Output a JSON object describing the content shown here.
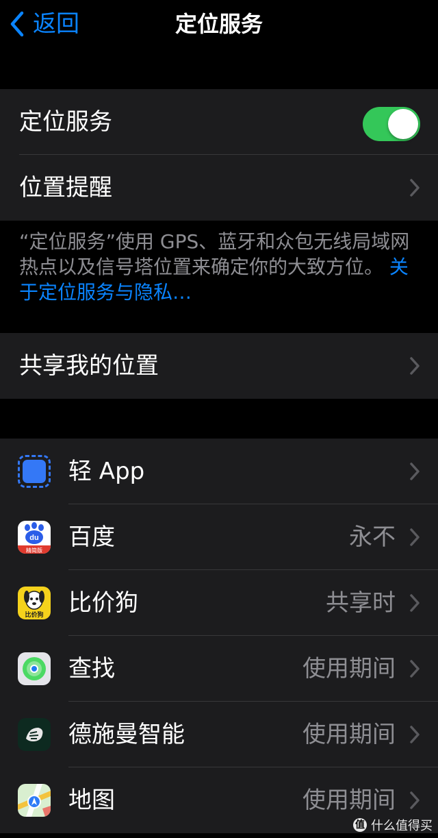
{
  "nav": {
    "back_label": "返回",
    "title": "定位服务"
  },
  "main_group": {
    "location_services_label": "定位服务",
    "location_services_on": true,
    "location_alerts_label": "位置提醒"
  },
  "note": {
    "text": "“定位服务”使用 GPS、蓝牙和众包无线局域网热点以及信号塔位置来确定你的大致方位。",
    "link": "关于定位服务与隐私…"
  },
  "share_group": {
    "share_label": "共享我的位置"
  },
  "apps": [
    {
      "name": "轻 App",
      "value": "",
      "icon": "app-clip-icon"
    },
    {
      "name": "百度",
      "value": "永不",
      "icon": "baidu-icon"
    },
    {
      "name": "比价狗",
      "value": "共享时",
      "icon": "bijiagou-icon"
    },
    {
      "name": "查找",
      "value": "使用期间",
      "icon": "find-my-icon"
    },
    {
      "name": "德施曼智能",
      "value": "使用期间",
      "icon": "dessmann-icon"
    },
    {
      "name": "地图",
      "value": "使用期间",
      "icon": "maps-icon"
    }
  ],
  "icon_text": {
    "baidu_logo": "du",
    "baidu_sub": "精简版",
    "bijiagou_text": "比价狗"
  },
  "watermark": {
    "badge": "值",
    "text": "什么值得买"
  },
  "colors": {
    "accent": "#0a84ff",
    "toggle_on": "#34c759",
    "cell_bg": "#1c1c1e",
    "secondary_text": "#8e8e93"
  }
}
